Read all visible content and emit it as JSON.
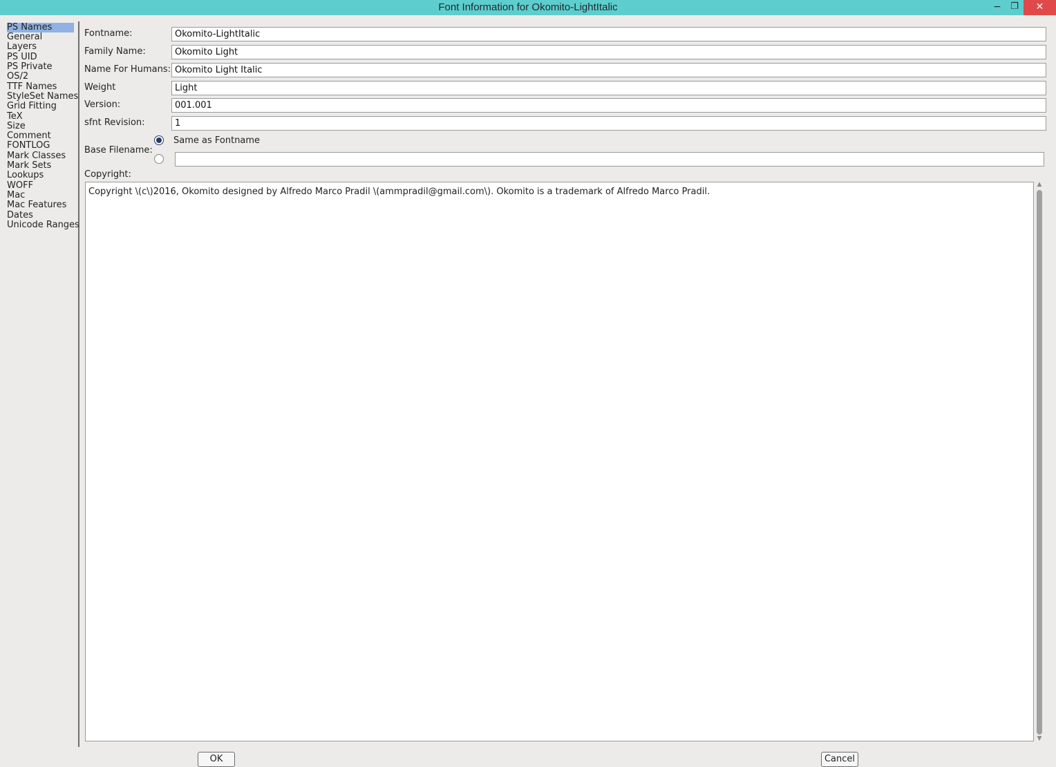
{
  "window": {
    "title": "Font Information for Okomito-LightItalic",
    "minimize_glyph": "−",
    "restore_glyph": "❐",
    "close_glyph": "✕"
  },
  "sidebar": {
    "items": [
      "PS Names",
      "General",
      "Layers",
      "PS UID",
      "PS Private",
      "OS/2",
      "TTF Names",
      "StyleSet Names",
      "Grid Fitting",
      "TeX",
      "Size",
      "Comment",
      "FONTLOG",
      "Mark Classes",
      "Mark Sets",
      "Lookups",
      "WOFF",
      "Mac",
      "Mac Features",
      "Dates",
      "Unicode Ranges"
    ],
    "selected": "PS Names"
  },
  "form": {
    "fontname_label": "Fontname:",
    "fontname_value": "Okomito-LightItalic",
    "family_label": "Family Name:",
    "family_value": "Okomito Light",
    "humans_label": "Name For Humans:",
    "humans_value": "Okomito Light Italic",
    "weight_label": "Weight",
    "weight_value": "Light",
    "version_label": "Version:",
    "version_value": "001.001",
    "sfnt_label": "sfnt Revision:",
    "sfnt_value": "1",
    "base_label": "Base Filename:",
    "base_option_same": "Same as Fontname",
    "base_custom_value": "",
    "copyright_label": "Copyright:",
    "copyright_value": "Copyright \\(c\\)2016, Okomito designed by Alfredo Marco Pradil \\(ammpradil@gmail.com\\). Okomito is a trademark of Alfredo Marco Pradil."
  },
  "buttons": {
    "ok": "OK",
    "cancel": "Cancel"
  },
  "colors": {
    "titlebar": "#5ecdcd",
    "close_button": "#e0494a",
    "selection": "#8fb2e2",
    "radio_checked": "#223c6b"
  }
}
